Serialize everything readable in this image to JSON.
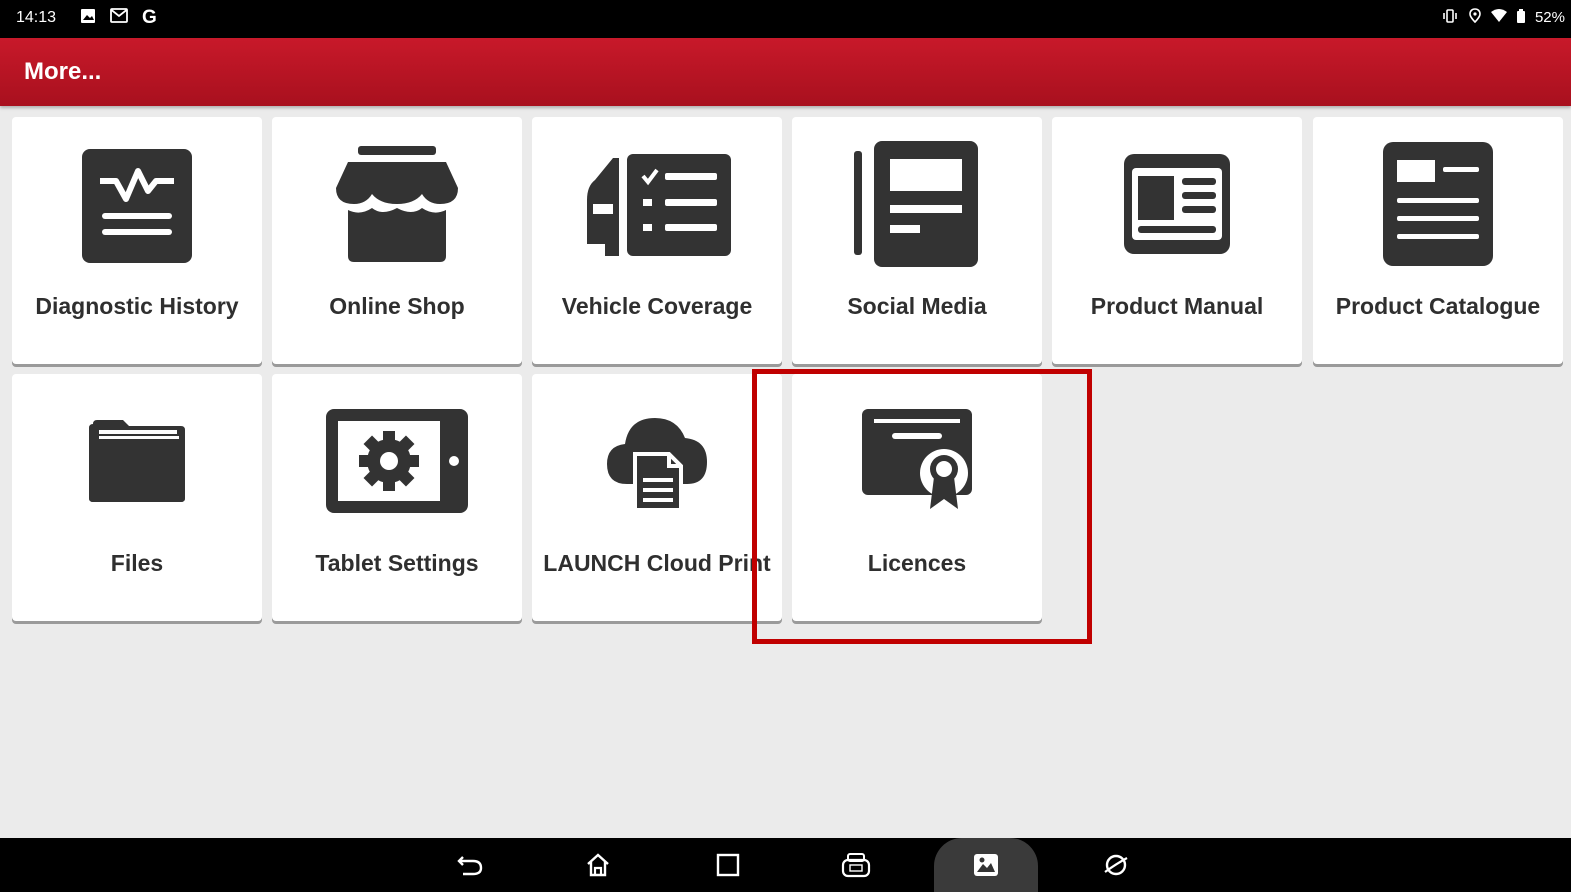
{
  "status_bar": {
    "time": "14:13",
    "left_icons": [
      "image-notification-icon",
      "gmail-icon",
      "google-icon"
    ],
    "right_icons": [
      "vibrate-icon",
      "location-icon",
      "wifi-icon",
      "battery-icon"
    ],
    "battery": "52%"
  },
  "app_bar": {
    "title": "More..."
  },
  "tiles": [
    {
      "label": "Diagnostic History",
      "icon": "diagnostic-history-icon"
    },
    {
      "label": "Online Shop",
      "icon": "shop-icon"
    },
    {
      "label": "Vehicle Coverage",
      "icon": "vehicle-coverage-icon"
    },
    {
      "label": "Social Media",
      "icon": "social-media-icon"
    },
    {
      "label": "Product Manual",
      "icon": "product-manual-icon"
    },
    {
      "label": "Product Catalogue",
      "icon": "product-catalogue-icon"
    },
    {
      "label": "Files",
      "icon": "folder-icon"
    },
    {
      "label": "Tablet Settings",
      "icon": "tablet-settings-icon"
    },
    {
      "label": "LAUNCH Cloud Print",
      "icon": "cloud-print-icon"
    },
    {
      "label": "Licences",
      "icon": "licence-certificate-icon"
    }
  ],
  "highlight": {
    "target": "Licences",
    "color": "#c00000"
  },
  "nav_bar": {
    "buttons": [
      "back-icon",
      "home-icon",
      "recents-icon",
      "vci-icon",
      "gallery-icon",
      "browser-icon"
    ],
    "active": "gallery-icon"
  },
  "colors": {
    "accent": "#c8192a",
    "icon": "#333333",
    "background": "#ebebeb"
  }
}
